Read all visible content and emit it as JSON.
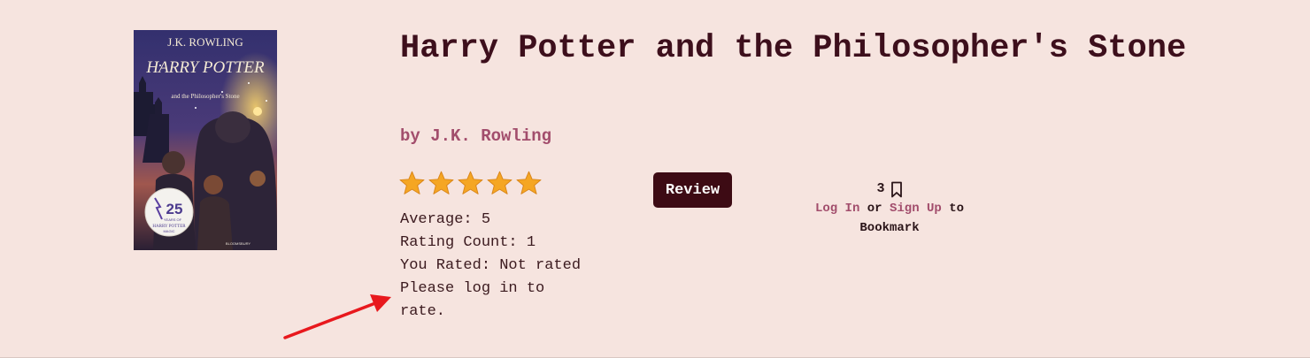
{
  "book": {
    "title": "Harry Potter and the Philosopher's Stone",
    "author_prefix": "by",
    "author": "J.K. Rowling",
    "cover": {
      "author_text": "J.K. ROWLING",
      "series_text": "HARRY POTTER",
      "subtitle_text": "and the Philosopher's Stone",
      "badge_number": "25",
      "badge_text": "YEARS OF",
      "badge_text2": "HARRY POTTER",
      "badge_text3": "MAGIC",
      "publisher": "BLOOMSBURY"
    }
  },
  "rating": {
    "stars": 5,
    "max_stars": 5,
    "star_color": "#f5a623",
    "average_label": "Average: 5",
    "count_label": "Rating Count: 1",
    "you_rated_label": "You Rated: Not rated",
    "login_message": "Please log in to rate."
  },
  "review_button": {
    "label": "Review",
    "color": "#3d0b14"
  },
  "bookmark": {
    "count": "3",
    "icon": "bookmark-icon",
    "login_link": "Log In",
    "or_text": "or",
    "signup_link": "Sign Up",
    "suffix": "to Bookmark"
  },
  "colors": {
    "background": "#f6e4df",
    "title": "#3d0f1c",
    "accent": "#a24d6c",
    "annotation_arrow": "#e8181d"
  }
}
